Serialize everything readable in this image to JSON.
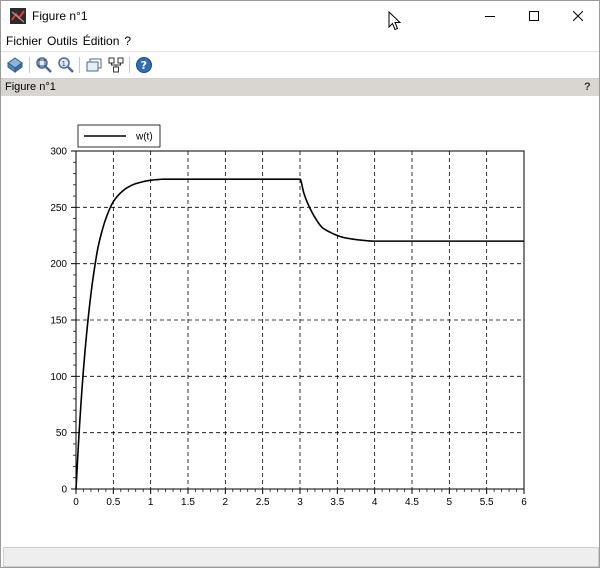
{
  "window": {
    "title": "Figure n°1"
  },
  "menu": {
    "items": [
      "Fichier",
      "Outils",
      "Édition",
      "?"
    ]
  },
  "toolbar": {
    "icons": [
      "rotate-icon",
      "zoom-icon",
      "zoom-reset-icon",
      "window-icon",
      "datatip-icon",
      "help-icon"
    ]
  },
  "figure": {
    "label": "Figure n°1",
    "help": "?"
  },
  "colors": {
    "curve": "#000000",
    "grid": "#000000",
    "figbar": "#d9d6d2"
  },
  "chart_data": {
    "type": "line",
    "title": "",
    "xlabel": "",
    "ylabel": "",
    "xlim": [
      0,
      6
    ],
    "ylim": [
      0,
      300
    ],
    "xticks": [
      "0",
      "0.5",
      "1",
      "1.5",
      "2",
      "2.5",
      "3",
      "3.5",
      "4",
      "4.5",
      "5",
      "5.5",
      "6"
    ],
    "yticks": [
      "0",
      "50",
      "100",
      "150",
      "200",
      "250",
      "300"
    ],
    "grid": true,
    "legend_position": "top-left",
    "series": [
      {
        "name": "w(t)",
        "x": [
          0,
          0.05,
          0.1,
          0.15,
          0.2,
          0.25,
          0.3,
          0.4,
          0.5,
          0.6,
          0.7,
          0.8,
          1.0,
          1.2,
          1.5,
          2.0,
          2.5,
          3.0,
          3.05,
          3.1,
          3.2,
          3.3,
          3.4,
          3.5,
          3.6,
          3.8,
          4.0,
          4.5,
          5.0,
          5.5,
          6.0
        ],
        "y": [
          0,
          59,
          106,
          143,
          173,
          197,
          216,
          240,
          255,
          263,
          268,
          271,
          274,
          275,
          275,
          275,
          275,
          275,
          263,
          254,
          241,
          232,
          228,
          225,
          223,
          221,
          220,
          220,
          220,
          220,
          220
        ]
      }
    ]
  }
}
